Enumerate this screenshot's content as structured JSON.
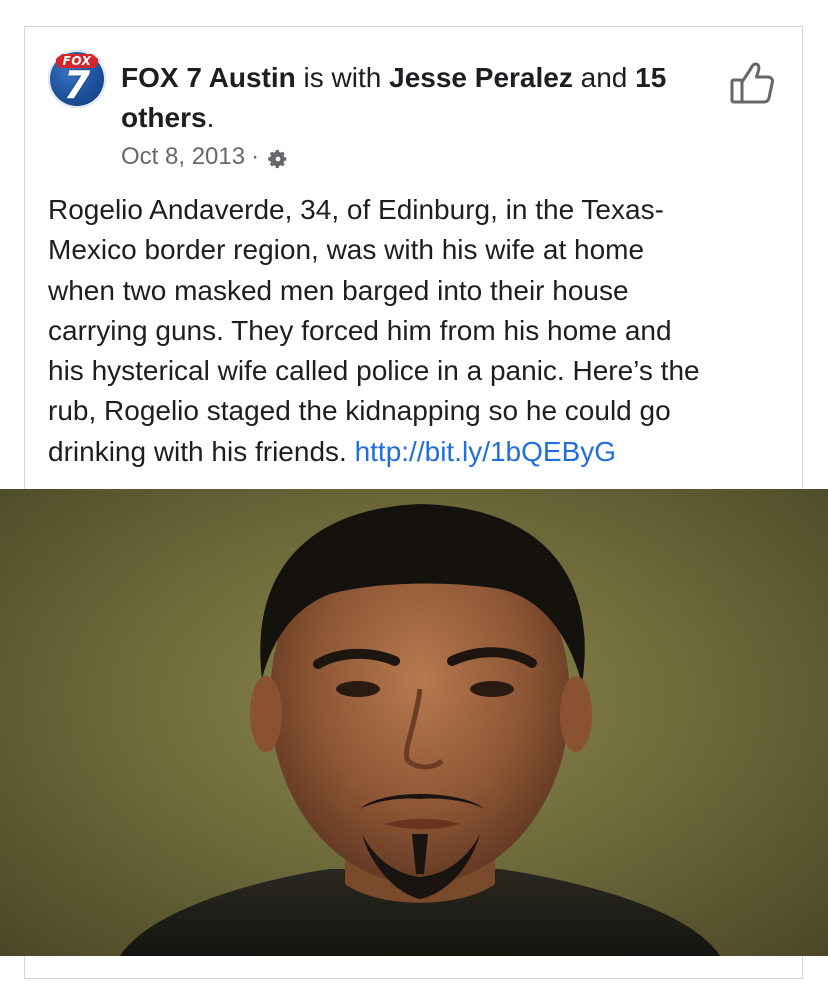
{
  "post": {
    "page_name": "FOX 7 Austin",
    "is_with_text": " is with ",
    "tagged_person": "Jesse Peralez",
    "and_text": " and ",
    "others_count": "15",
    "others_text": "others",
    "period": ".",
    "date": "Oct 8, 2013",
    "separator": "·",
    "body": "Rogelio Andaverde, 34, of Edinburg, in the Texas-\nMexico border region, was with his wife at home\nwhen two masked men barged into their house\ncarrying guns. They forced him from his home and\nhis hysterical wife called police in a panic. Here’s the\nrub, Rogelio staged the kidnapping so he could go\ndrinking with his friends. ",
    "link": "http://bit.ly/1bQEByG"
  },
  "avatar": {
    "banner_text": "FOX",
    "number_text": "7"
  },
  "icons": {
    "privacy": "gear-icon",
    "like": "thumbs-up-icon"
  },
  "colors": {
    "link": "#216fdb",
    "meta": "#65676b",
    "text": "#1c1e21",
    "brand_red": "#d6262b",
    "brand_blue": "#1d4f9a"
  }
}
